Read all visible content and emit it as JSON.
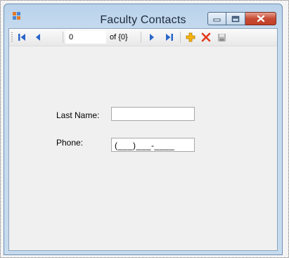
{
  "window": {
    "title": "Faculty Contacts"
  },
  "navigator": {
    "position": "0",
    "count_label": "of {0}"
  },
  "form": {
    "last_name_label": "Last Name:",
    "last_name_value": "",
    "phone_label": "Phone:",
    "phone_mask": "(___)___-____"
  },
  "icons": {
    "app": "app-icon",
    "move_first": "move-first-icon",
    "move_previous": "move-previous-icon",
    "move_next": "move-next-icon",
    "move_last": "move-last-icon",
    "add_new": "add-icon",
    "delete": "delete-icon",
    "save": "save-icon"
  },
  "colors": {
    "title_bar": "#c7dbef",
    "close_button": "#c74a33",
    "nav_arrow": "#2a66c9",
    "add_icon": "#e8a400",
    "delete_icon": "#e33a1b"
  }
}
